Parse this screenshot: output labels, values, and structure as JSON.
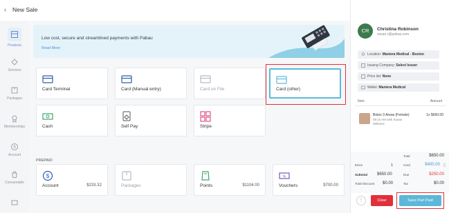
{
  "header": {
    "back_icon": "chevron-left-icon",
    "title": "New Sale"
  },
  "sidebar": {
    "items": [
      {
        "label": "Products",
        "icon": "products-icon",
        "active": true
      },
      {
        "label": "Services",
        "icon": "services-icon"
      },
      {
        "label": "Packages",
        "icon": "packages-icon"
      },
      {
        "label": "Memberships",
        "icon": "memberships-icon"
      },
      {
        "label": "Account",
        "icon": "account-icon"
      },
      {
        "label": "Consumable",
        "icon": "consumable-icon"
      },
      {
        "label": "",
        "icon": "more-icon"
      }
    ]
  },
  "banner": {
    "text": "Low cost, secure and streamlined payments with Pabau",
    "link": "Read More"
  },
  "payment_methods": [
    {
      "label": "Card Terminal",
      "icon": "card-icon",
      "enabled": true
    },
    {
      "label": "Card (Manual entry)",
      "icon": "card-icon",
      "enabled": true
    },
    {
      "label": "Card on File",
      "icon": "card-icon",
      "enabled": false
    },
    {
      "label": "Card (other)",
      "icon": "card-icon",
      "enabled": true,
      "selected": true
    },
    {
      "label": "Cash",
      "icon": "cash-icon",
      "enabled": true
    },
    {
      "label": "Self Pay",
      "icon": "self-pay-icon",
      "enabled": true
    },
    {
      "label": "Stripe",
      "icon": "stripe-icon",
      "enabled": true
    }
  ],
  "prepaid": {
    "label": "PREPAID",
    "items": [
      {
        "label": "Account",
        "amount": "$233.32",
        "icon": "dollar-icon",
        "enabled": true
      },
      {
        "label": "Packages",
        "amount": "",
        "icon": "package-icon",
        "enabled": false
      },
      {
        "label": "Points",
        "amount": "$1104.00",
        "icon": "points-icon",
        "enabled": true
      },
      {
        "label": "Vouchers",
        "amount": "$700.00",
        "icon": "voucher-icon",
        "enabled": true
      }
    ]
  },
  "client": {
    "initials": "CR",
    "name": "Christina Robinson",
    "email": "susan.r@pabau.com",
    "avatar_color": "#3d7a4c"
  },
  "info": {
    "location_label": "Location:",
    "location_value": "Maniera Medical - Boston",
    "issuing_label": "Issuing Company:",
    "issuing_value": "Select Issuer",
    "price_label": "Price list:",
    "price_value": "None",
    "wallet_label": "Wallet:",
    "wallet_value": "Maniera Medical"
  },
  "cart": {
    "item_head": "Item",
    "amount_head": "Amount",
    "line": {
      "name": "Botox 3 Areas (Female)",
      "meta": "09:15 AM with Susan Williams",
      "amount": "1x $650.00"
    }
  },
  "totals": {
    "total_label": "Total",
    "total_value": "$650.00",
    "items_label": "Items",
    "items_value": "1",
    "card_label": "Card",
    "card_value": "$400.00",
    "subtotal_label": "Subtotal",
    "subtotal_value": "$650.00",
    "due_label": "Due",
    "due_value": "$250.00",
    "discount_label": "Total Discount",
    "discount_value": "$0.00",
    "tax_label": "Tax",
    "tax_value": "$0.00"
  },
  "actions": {
    "more": "⋮",
    "clear": "Clear",
    "save": "Save Part Paid"
  },
  "colors": {
    "accent": "#5cb8d9",
    "danger": "#e0303a",
    "due": "#e0303a",
    "card_value": "#4a90d9"
  }
}
